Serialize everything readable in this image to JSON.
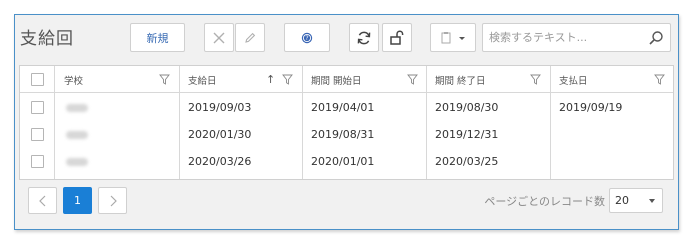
{
  "page_title": "支給回",
  "toolbar": {
    "new_label": "新規",
    "icons": [
      "close-icon",
      "pencil-icon",
      "help-icon",
      "refresh-icon",
      "unlock-icon",
      "clipboard-dropdown-icon"
    ],
    "search_placeholder": "検索するテキスト..."
  },
  "grid": {
    "columns": [
      "学校",
      "支給日",
      "期間 開始日",
      "期間 終了日",
      "支払日"
    ],
    "sort_indicator": "↑",
    "rows": [
      {
        "school": "",
        "payment_day": "2019/09/03",
        "start": "2019/04/01",
        "end": "2019/08/30",
        "paid": "2019/09/19"
      },
      {
        "school": "",
        "payment_day": "2020/01/30",
        "start": "2019/08/31",
        "end": "2019/12/31",
        "paid": ""
      },
      {
        "school": "",
        "payment_day": "2020/03/26",
        "start": "2020/01/01",
        "end": "2020/03/25",
        "paid": ""
      }
    ]
  },
  "pager": {
    "current_page": "1",
    "per_page_label": "ページごとのレコード数",
    "per_page_value": "20"
  },
  "colors": {
    "accent": "#1a7fd6",
    "frame_border": "#4a90c8",
    "link": "#3b6db5"
  }
}
